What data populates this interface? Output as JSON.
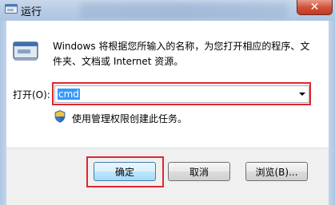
{
  "window": {
    "title": "运行",
    "close_glyph": "✕"
  },
  "description": "Windows 将根据您所输入的名称，为您打开相应的程序、文件夹、文档或 Internet 资源。",
  "open_field": {
    "label": "打开(O):",
    "value": "cmd"
  },
  "admin_note": "使用管理权限创建此任务。",
  "buttons": {
    "ok": "确定",
    "cancel": "取消",
    "browse": "浏览(B)..."
  },
  "highlight_color": "#e0262e",
  "icons": [
    "run-app-icon",
    "run-dialog-icon",
    "uac-shield-icon",
    "close-icon",
    "dropdown-arrow-icon"
  ]
}
